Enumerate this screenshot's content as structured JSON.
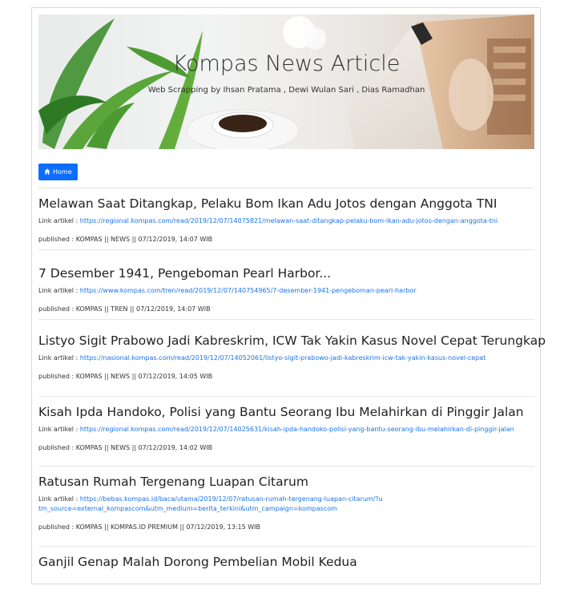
{
  "header": {
    "title": "Kompas News Article",
    "subtitle": "Web Scrapping by Ihsan Pratama , Dewi Wulan Sari , Dias Ramadhan"
  },
  "nav": {
    "home_label": "Home",
    "home_icon": "home-icon"
  },
  "labels": {
    "link_prefix": "Link artikel : ",
    "published_prefix": "published : "
  },
  "articles": [
    {
      "title": "Melawan Saat Ditangkap, Pelaku Bom Ikan Adu Jotos dengan Anggota TNI",
      "link": "https://regional.kompas.com/read/2019/12/07/14075821/melawan-saat-ditangkap-pelaku-bom-ikan-adu-jotos-dengan-anggota-tni",
      "meta": "KOMPAS || NEWS || 07/12/2019, 14:07 WIB"
    },
    {
      "title": "7 Desember 1941, Pengeboman Pearl Harbor...",
      "link": "https://www.kompas.com/tren/read/2019/12/07/140754965/7-desember-1941-pengeboman-pearl-harbor",
      "meta": "KOMPAS || TREN || 07/12/2019, 14:07 WIB"
    },
    {
      "title": "Listyo Sigit Prabowo Jadi Kabreskrim, ICW Tak Yakin Kasus Novel Cepat Terungkap",
      "link": "https://nasional.kompas.com/read/2019/12/07/14052061/listyo-sigit-prabowo-jadi-kabreskrim-icw-tak-yakin-kasus-novel-cepat",
      "meta": "KOMPAS || NEWS || 07/12/2019, 14:05 WIB"
    },
    {
      "title": "Kisah Ipda Handoko, Polisi yang Bantu Seorang Ibu Melahirkan di Pinggir Jalan",
      "link": "https://regional.kompas.com/read/2019/12/07/14025631/kisah-ipda-handoko-polisi-yang-bantu-seorang-ibu-melahirkan-di-pinggir-jalan",
      "meta": "KOMPAS || NEWS || 07/12/2019, 14:02 WIB"
    },
    {
      "title": "Ratusan Rumah Tergenang Luapan Citarum",
      "link": "https://bebas.kompas.id/baca/utama/2019/12/07/ratusan-rumah-tergenang-luapan-citarum/?utm_source=external_kompascom&utm_medium=berita_terkini&utm_campaign=kompascom",
      "meta": "KOMPAS || KOMPAS.ID PREMIUM || 07/12/2019, 13:15 WIB"
    },
    {
      "title": "Ganjil Genap Malah Dorong Pembelian Mobil Kedua",
      "link": "",
      "meta": ""
    }
  ]
}
